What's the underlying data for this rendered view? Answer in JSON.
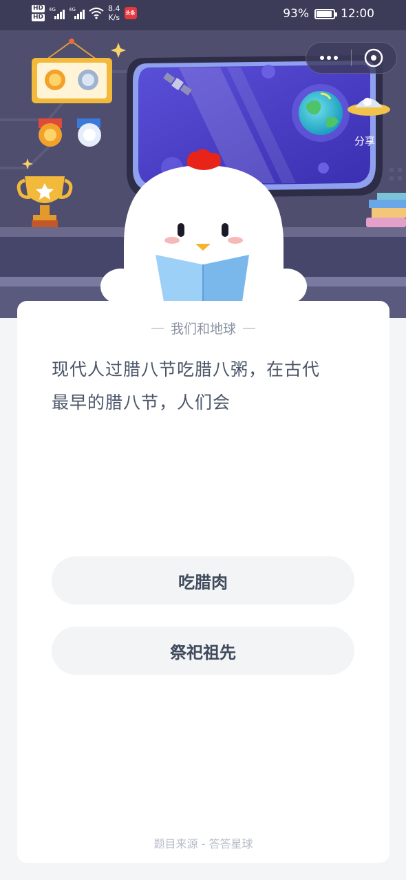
{
  "status_bar": {
    "hd1": "HD",
    "hd2": "HD",
    "net1": "4G",
    "net2": "4G",
    "speed_value": "8.4",
    "speed_unit": "K/s",
    "app_badge": "头条",
    "battery_text": "93%",
    "battery_level": 0.93,
    "time": "12:00"
  },
  "toolbar": {
    "more_icon": "ellipsis-icon",
    "close_icon": "target-close-icon",
    "share_label": "分享"
  },
  "hero": {
    "icons": [
      "medal-plaque-icon",
      "medal-icon",
      "trophy-icon",
      "satellite-icon",
      "planet-icon",
      "ufo-icon",
      "chick-mascot-icon",
      "books-icon"
    ]
  },
  "card": {
    "category": "我们和地球",
    "question_line1": "现代人过腊八节吃腊八粥，在古代",
    "question_line2": "最早的腊八节，人们会",
    "options": [
      "吃腊肉",
      "祭祀祖先"
    ],
    "source": "题目来源 - 答答星球"
  },
  "colors": {
    "status_bg": "#3c3b58",
    "hero_bg": "#4f4e6e",
    "card_bg": "#ffffff",
    "page_bg": "#f4f5f6",
    "question_text": "#4a5567",
    "option_bg": "#f3f4f6"
  }
}
